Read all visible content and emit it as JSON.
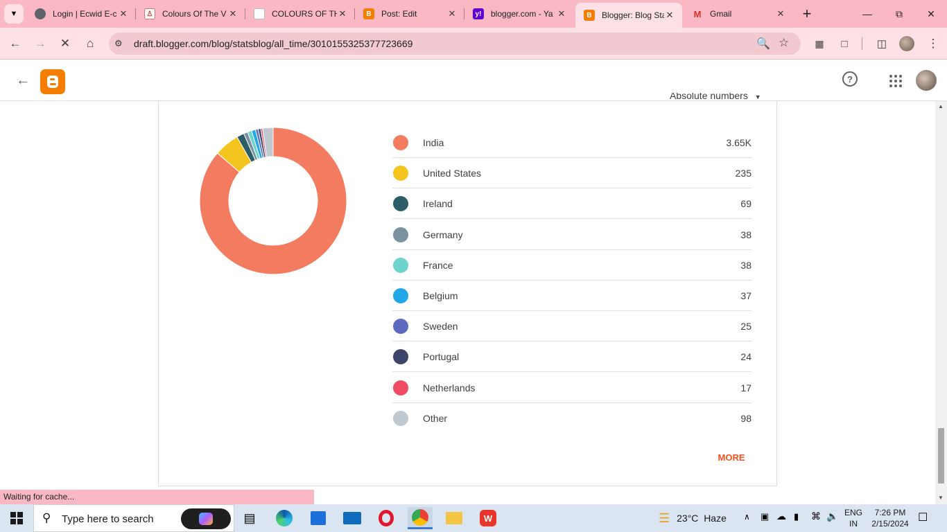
{
  "browser": {
    "tabs": [
      {
        "title": "Login | Ecwid E-c",
        "favicon": "globe-icon"
      },
      {
        "title": "Colours Of The V",
        "favicon": "colours-icon"
      },
      {
        "title": "COLOURS OF TH",
        "favicon": "page-icon"
      },
      {
        "title": "Post: Edit",
        "favicon": "blogger-icon"
      },
      {
        "title": "blogger.com - Ya",
        "favicon": "yahoo-icon"
      },
      {
        "title": "Blogger: Blog Sta",
        "favicon": "blogger-icon"
      },
      {
        "title": "Gmail",
        "favicon": "gmail-icon"
      }
    ],
    "active_tab_index": 5,
    "url": "draft.blogger.com/blog/statsblog/all_time/3010155325377723669",
    "status_text": "Waiting for cache..."
  },
  "stats": {
    "partial_header": "Absolute numbers",
    "more_label": "MORE",
    "countries": [
      {
        "name": "India",
        "value": "3.65K",
        "num": 3650,
        "color": "#f37c60"
      },
      {
        "name": "United States",
        "value": "235",
        "num": 235,
        "color": "#f4c51f"
      },
      {
        "name": "Ireland",
        "value": "69",
        "num": 69,
        "color": "#2d5e67"
      },
      {
        "name": "Germany",
        "value": "38",
        "num": 38,
        "color": "#7b93a1"
      },
      {
        "name": "France",
        "value": "38",
        "num": 38,
        "color": "#6cd3cd"
      },
      {
        "name": "Belgium",
        "value": "37",
        "num": 37,
        "color": "#20a7e8"
      },
      {
        "name": "Sweden",
        "value": "25",
        "num": 25,
        "color": "#5c6bc0"
      },
      {
        "name": "Portugal",
        "value": "24",
        "num": 24,
        "color": "#3c4569"
      },
      {
        "name": "Netherlands",
        "value": "17",
        "num": 17,
        "color": "#ef4d64"
      },
      {
        "name": "Other",
        "value": "98",
        "num": 98,
        "color": "#c1c9d0"
      }
    ]
  },
  "taskbar": {
    "search_placeholder": "Type here to search",
    "weather": "23°C  Haze",
    "lang_top": "ENG",
    "lang_bottom": "IN",
    "time": "7:26 PM",
    "date": "2/15/2024"
  },
  "colors": {
    "accent": "#f4511e",
    "blogger": "#f57d00",
    "chrome_frame": "#f9b8c4"
  }
}
